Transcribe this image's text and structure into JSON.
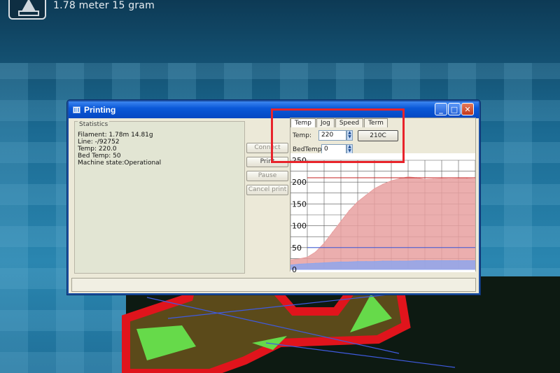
{
  "header": {
    "icon": "print-tray-icon",
    "info": "1.78 meter 15 gram"
  },
  "window": {
    "title": "Printing",
    "controls": [
      "_",
      "□",
      "✕"
    ]
  },
  "stats": {
    "legend": "Statistics",
    "filament": "Filament: 1.78m 14.81g",
    "line": "Line: -/92752",
    "temp": "Temp: 220.0",
    "bed_temp": "Bed Temp: 50",
    "machine_state": "Machine state:Operational"
  },
  "buttons": {
    "connect": "Connect",
    "print": "Print",
    "pause": "Pause",
    "cancel": "Cancel print"
  },
  "tabs": [
    {
      "label": "Temp",
      "active": true
    },
    {
      "label": "Jog",
      "active": false
    },
    {
      "label": "Speed",
      "active": false
    },
    {
      "label": "Term",
      "active": false
    }
  ],
  "temp_panel": {
    "temp_label": "Temp:",
    "temp_value": "220",
    "set_button": "210C",
    "bed_label": "BedTemp:",
    "bed_value": "0"
  },
  "chart_data": {
    "type": "area",
    "ylim": [
      0,
      250
    ],
    "yticks": [
      0,
      50,
      100,
      150,
      200,
      250
    ],
    "ytick_labels": [
      "0",
      "50",
      "100",
      "150",
      "200",
      "250"
    ],
    "grid": true,
    "series": [
      {
        "color": "#e8a0a0",
        "values": [
          22,
          24,
          28,
          40,
          60,
          85,
          110,
          135,
          155,
          170,
          185,
          195,
          203,
          208,
          212,
          210,
          206,
          207,
          208,
          207,
          208,
          208,
          207
        ]
      },
      {
        "color": "#8fa6ec",
        "values": [
          10,
          12,
          13,
          14,
          15,
          16,
          17,
          17,
          18,
          18,
          18,
          19,
          19,
          19,
          19,
          20,
          20,
          20,
          20,
          20,
          20,
          20,
          20
        ]
      }
    ],
    "target_lines": [
      {
        "color": "#c41f1f",
        "value": 210
      },
      {
        "color": "#3a57d6",
        "value": 50
      }
    ]
  },
  "colors": {
    "annotation": "#e8242b",
    "titlebar": "#0a58d8"
  }
}
